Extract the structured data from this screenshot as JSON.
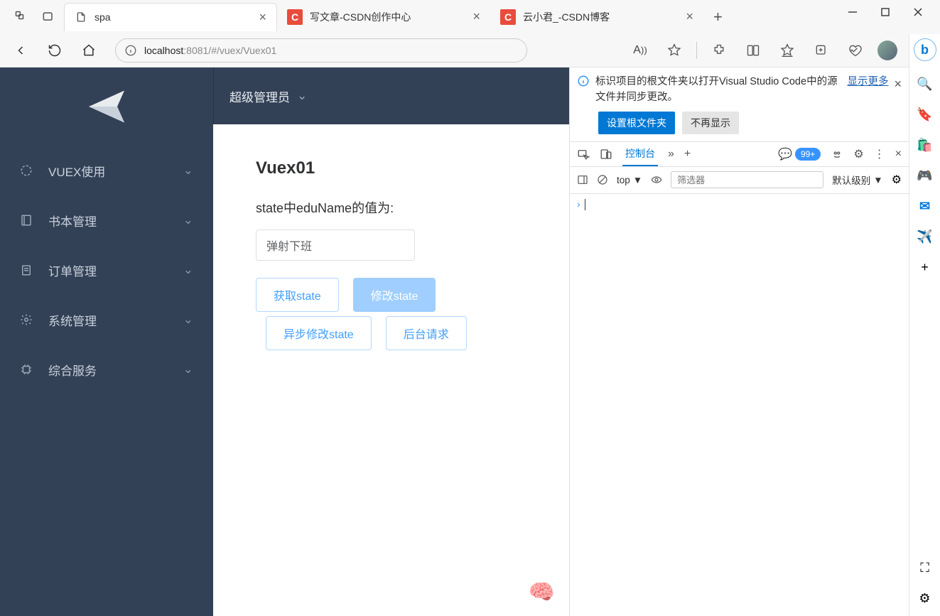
{
  "browser": {
    "tabs": [
      {
        "title": "spa",
        "favicon": "page"
      },
      {
        "title": "写文章-CSDN创作中心",
        "favicon": "C"
      },
      {
        "title": "云小君_-CSDN博客",
        "favicon": "C"
      }
    ],
    "url_prefix": "localhost",
    "url_suffix": ":8081/#/vuex/Vuex01",
    "issues_badge": "99+"
  },
  "sidebar": {
    "items": [
      {
        "icon": "loading",
        "label": "VUEX使用"
      },
      {
        "icon": "book",
        "label": "书本管理"
      },
      {
        "icon": "order",
        "label": "订单管理"
      },
      {
        "icon": "gear",
        "label": "系统管理"
      },
      {
        "icon": "chip",
        "label": "综合服务"
      }
    ]
  },
  "topbar": {
    "title": "超级管理员"
  },
  "content": {
    "heading": "Vuex01",
    "state_label": "state中eduName的值为:",
    "input_value": "弹射下班",
    "buttons": {
      "get": "获取state",
      "set": "修改state",
      "async_set": "异步修改state",
      "backend": "后台请求"
    }
  },
  "devtools": {
    "info_text": "标识项目的根文件夹以打开Visual Studio Code中的源文件并同步更改。",
    "more": "显示更多",
    "set_root": "设置根文件夹",
    "dont_show": "不再显示",
    "tab_console": "控制台",
    "context": "top",
    "filter_placeholder": "筛选器",
    "level_label": "默认级别"
  }
}
